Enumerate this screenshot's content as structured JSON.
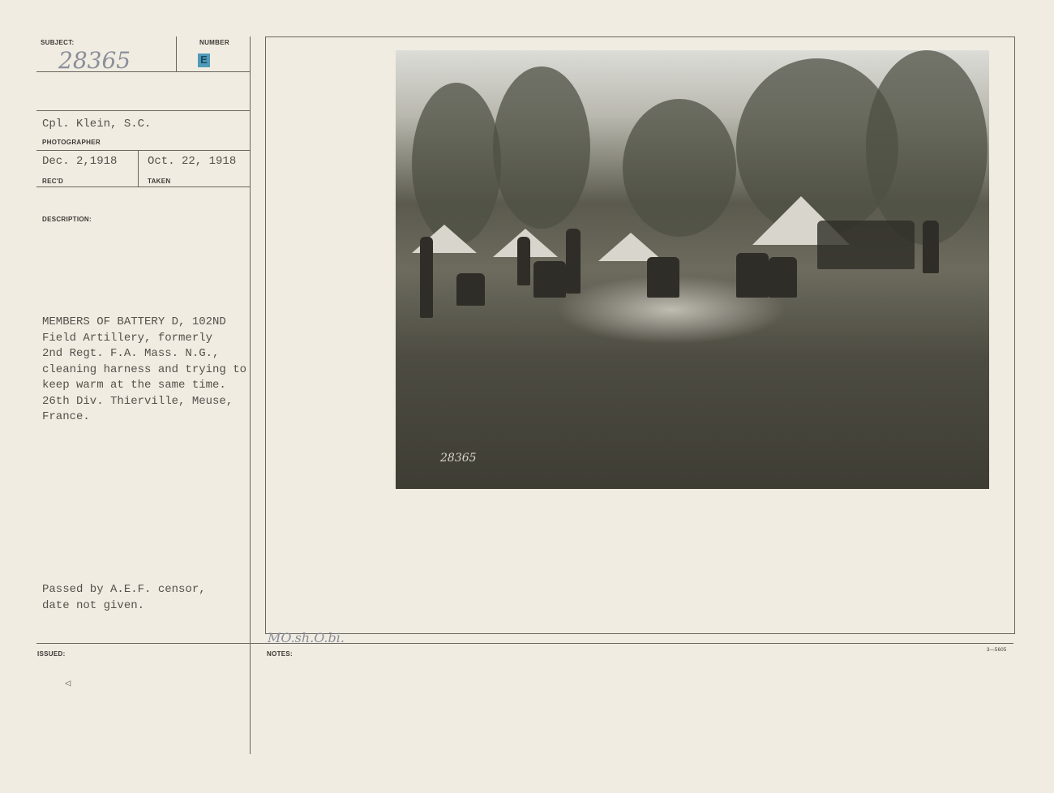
{
  "card": {
    "subject_label": "SUBJECT:",
    "subject_number": "28365",
    "number_label": "NUMBER",
    "number_stamp": "E",
    "photographer": "Cpl. Klein, S.C.",
    "photographer_label": "PHOTOGRAPHER",
    "received": "Dec. 2,1918",
    "received_label": "REC'D",
    "taken": "Oct. 22, 1918",
    "taken_label": "TAKEN",
    "description_label": "DESCRIPTION:",
    "description": "MEMBERS OF BATTERY D, 102ND\nField Artillery, formerly\n2nd Regt. F.A. Mass. N.G.,\ncleaning harness and trying to\nkeep warm at the same time.\n26th Div. Thierville, Meuse,\nFrance.",
    "censor_note": "Passed by A.E.F. censor,\ndate not given.",
    "issued_label": "ISSUED:",
    "notes_label": "NOTES:",
    "notes_handwritten": "MO.sh.O.bi.",
    "form_number": "3—5605",
    "photo_inscription": "28365"
  }
}
